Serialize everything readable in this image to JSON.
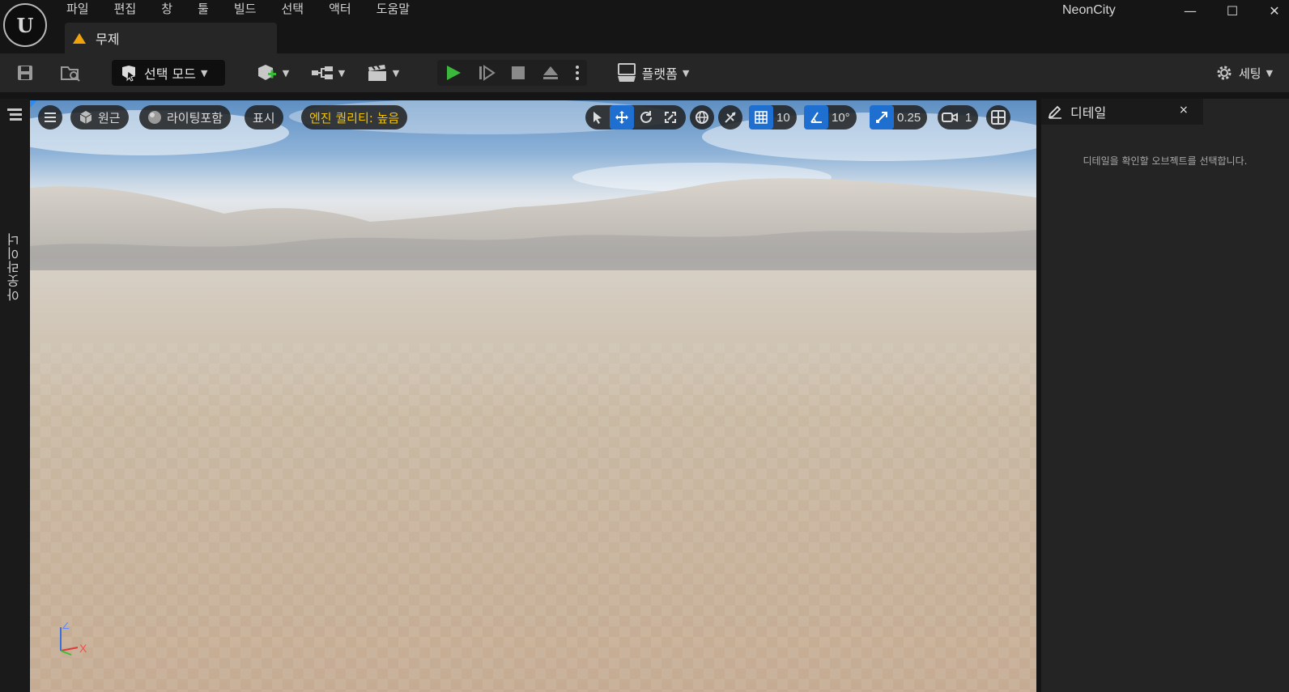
{
  "window": {
    "project_name": "NeonCity",
    "logo_text": "U",
    "minimize": "—",
    "maximize": "☐",
    "close": "✕"
  },
  "menu": {
    "items": [
      "파일",
      "편집",
      "창",
      "툴",
      "빌드",
      "선택",
      "액터",
      "도움말"
    ]
  },
  "level_tab": {
    "label": "무제",
    "warning_color": "#f0a30a"
  },
  "toolbar": {
    "mode_label": "선택 모드",
    "platform_label": "플랫폼",
    "settings_label": "세팅",
    "play_color": "#3bb83b"
  },
  "outliner": {
    "label": "아웃라이너"
  },
  "viewport": {
    "view_mode": "원근",
    "lighting": "라이팅포함",
    "show": "표시",
    "quality": "엔진 퀄리티: 높음",
    "grid_snap": "10",
    "rotation_snap": "10°",
    "scale_snap": "0.25",
    "camera_speed": "1",
    "accent_color": "#1f6fd1",
    "axis": {
      "z": "Z",
      "x": "X"
    }
  },
  "details": {
    "tab_label": "디테일",
    "close": "×",
    "empty_hint": "디테일을 확인할 오브젝트를 선택합니다."
  }
}
